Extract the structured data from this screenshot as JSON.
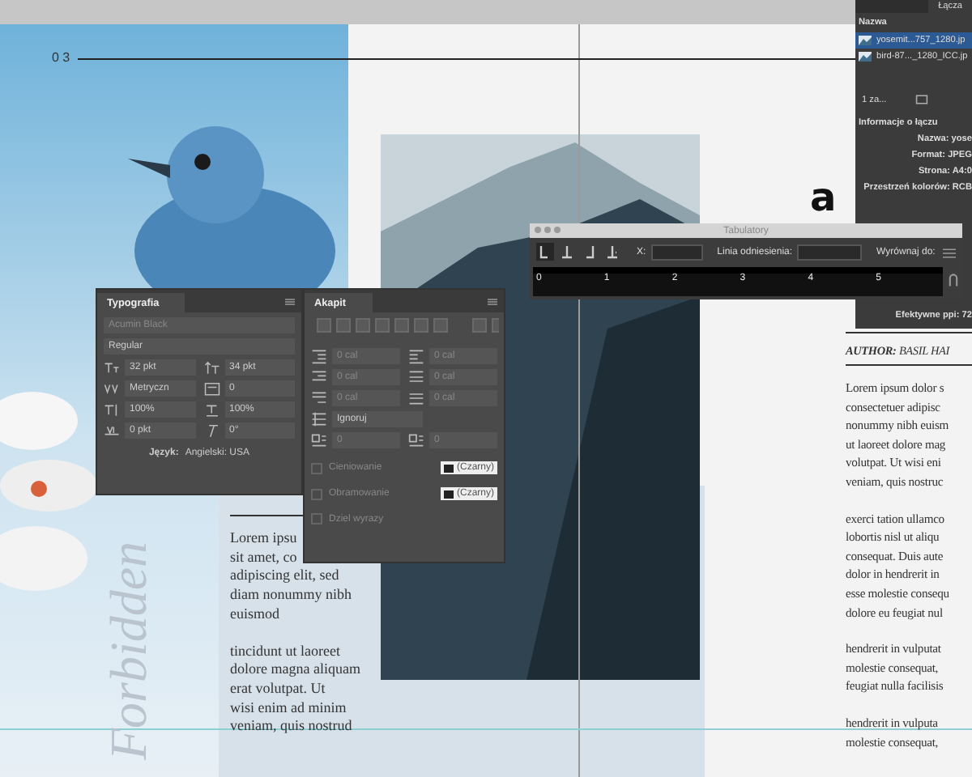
{
  "page": {
    "folio": "0 3",
    "letter": "a",
    "vertical_title": "Forbidden",
    "author": "**AUTHOR:** BASIL HAI",
    "left_column": [
      [
        "Lorem ipsu",
        "sit amet, co",
        "adipiscing elit, sed",
        "diam nonummy nibh",
        "euismod"
      ],
      [
        "tincidunt ut laoreet",
        "dolore magna aliquam",
        "erat volutpat. Ut",
        "wisi enim ad minim",
        "veniam, quis nostrud"
      ]
    ],
    "right_column": [
      [
        "Lorem ipsum dolor s",
        "consectetuer adipisc",
        "nonummy nibh euism",
        "ut laoreet dolore mag",
        "volutpat. Ut wisi eni",
        "veniam, quis nostruc"
      ],
      [
        "exerci tation ullamco",
        "lobortis nisl ut aliqu",
        "consequat. Duis aute",
        "dolor in hendrerit in",
        "esse molestie consequ",
        "dolore eu feugiat nul"
      ],
      [
        "hendrerit in vulputat",
        "molestie consequat,",
        "feugiat nulla facilisis"
      ],
      [
        "hendrerit in vulputa",
        "molestie consequat,"
      ]
    ]
  },
  "links_panel": {
    "tab": "Łącza",
    "column_header": "Nazwa",
    "files": [
      {
        "name": "yosemit...757_1280.jp",
        "selected": true
      },
      {
        "name": "bird-87..._1280_ICC.jp",
        "selected": false
      }
    ],
    "count": "1 za...",
    "info_title": "Informacje o łączu",
    "info": [
      {
        "label": "Nazwa:",
        "value": "yose"
      },
      {
        "label": "Format:",
        "value": "JPEG"
      },
      {
        "label": "Strona:",
        "value": "A4:0"
      },
      {
        "label": "Przestrzeń kolorów:",
        "value": "RCB"
      }
    ],
    "ppi": {
      "label": "Efektywne ppi:",
      "value": "72"
    }
  },
  "tabs_panel": {
    "title": "Tabulatory",
    "tab_types": [
      {
        "kind": "left",
        "selected": true
      },
      {
        "kind": "center",
        "selected": false
      },
      {
        "kind": "right",
        "selected": false
      },
      {
        "kind": "decimal",
        "selected": false
      }
    ],
    "x_label": "X:",
    "baseline_label": "Linia odniesienia:",
    "align_label": "Wyrównaj do:",
    "ruler": [
      "0",
      "1",
      "2",
      "3",
      "4",
      "5"
    ]
  },
  "typography_panel": {
    "title": "Typografia",
    "font": "Acumin Black",
    "style": "Regular",
    "fields": [
      {
        "kind": "size",
        "value": "32 pkt"
      },
      {
        "kind": "leading",
        "value": "34 pkt"
      },
      {
        "kind": "kerning",
        "value": "Metryczn"
      },
      {
        "kind": "tracking",
        "value": "0"
      },
      {
        "kind": "vscale",
        "value": "100%"
      },
      {
        "kind": "hscale",
        "value": "100%"
      },
      {
        "kind": "baseline",
        "value": "0 pkt"
      },
      {
        "kind": "skew",
        "value": "0°"
      }
    ],
    "language_label": "Język:",
    "language": "Angielski: USA"
  },
  "paragraph_panel": {
    "title": "Akapit",
    "fields": [
      {
        "kind": "left-indent",
        "value": "0 cal"
      },
      {
        "kind": "right-indent",
        "value": "0 cal"
      },
      {
        "kind": "first-indent",
        "value": "0 cal"
      },
      {
        "kind": "space-before",
        "value": "0 cal"
      },
      {
        "kind": "last-indent",
        "value": "0 cal"
      },
      {
        "kind": "space-after",
        "value": "0 cal"
      }
    ],
    "grid": "Ignoruj",
    "dropcap": [
      "0",
      "0"
    ],
    "options": [
      {
        "label": "Cieniowanie",
        "checked": false,
        "swatch": "(Czarny)"
      },
      {
        "label": "Obramowanie",
        "checked": false,
        "swatch": "(Czarny)"
      },
      {
        "label": "Dziel wyrazy",
        "checked": false
      }
    ]
  }
}
